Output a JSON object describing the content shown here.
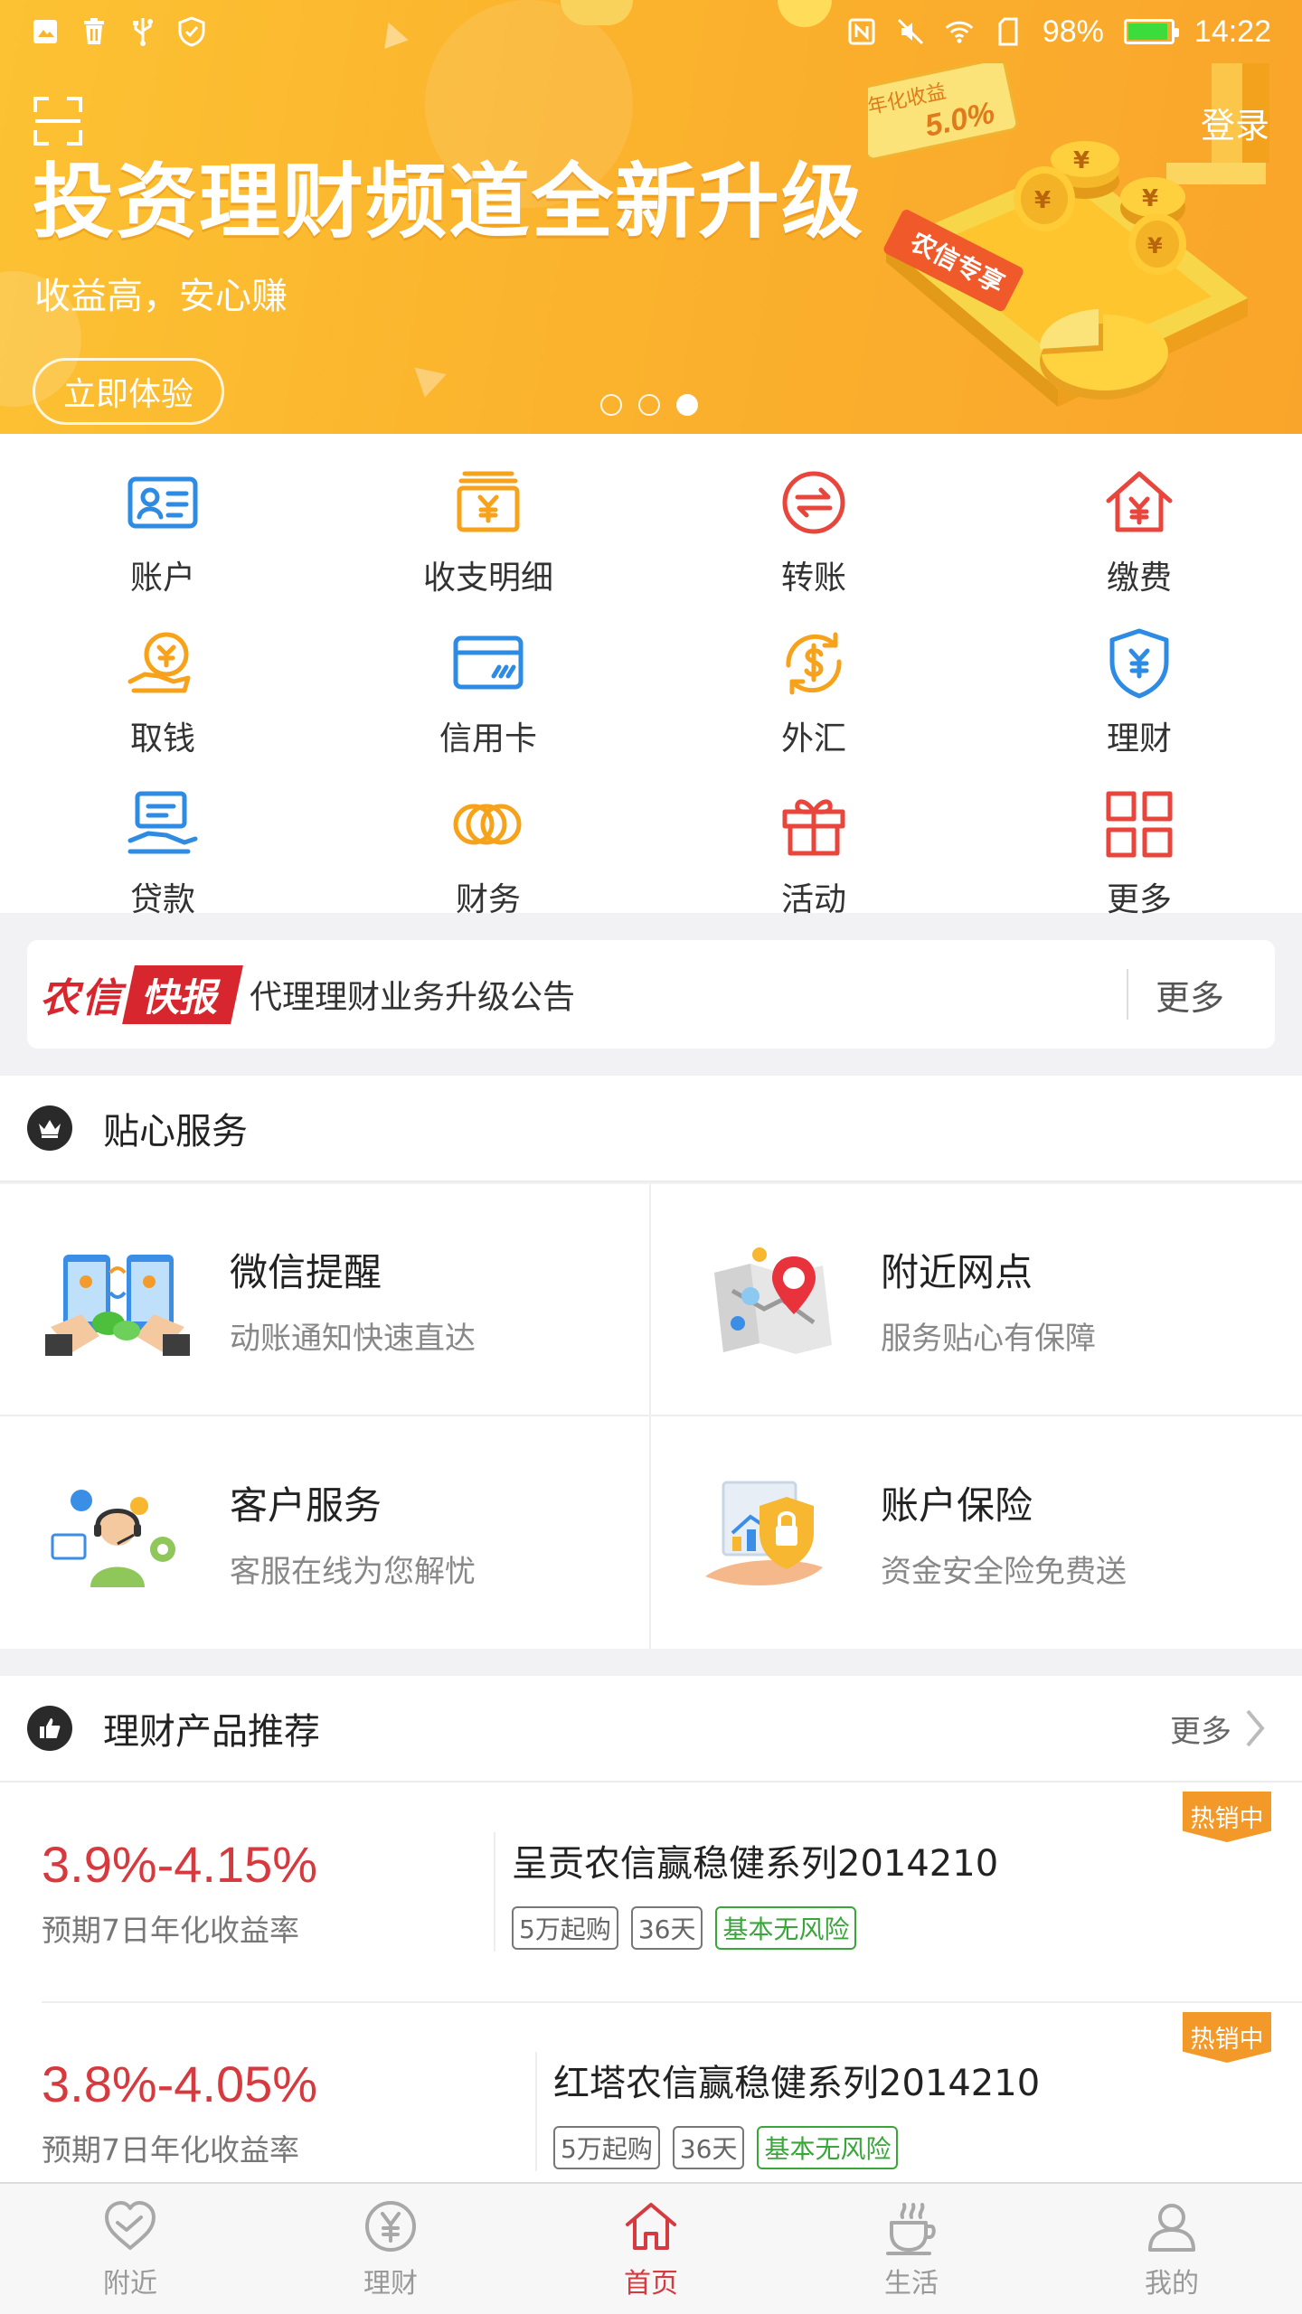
{
  "status_bar": {
    "battery": "98%",
    "time": "14:22"
  },
  "banner": {
    "title": "投资理财频道全新升级",
    "subtitle": "收益高，安心赚",
    "button": "立即体验",
    "login": "登录",
    "slide_count": 3,
    "active_slide": 3,
    "art_badge": "年化收益",
    "art_rate": "5.0%",
    "art_card": "农信专享",
    "currency_symbol": "¥"
  },
  "colors": {
    "accent_red": "#d63a3f",
    "blue": "#2e8be3",
    "orange": "#f7a21b",
    "green": "#3aa63a",
    "banner": "#fbb32d"
  },
  "menu": [
    {
      "label": "账户",
      "icon": "id-card-icon",
      "color": "#2e8be3"
    },
    {
      "label": "收支明细",
      "icon": "money-box-icon",
      "color": "#f7a21b"
    },
    {
      "label": "转账",
      "icon": "transfer-icon",
      "color": "#e8453c"
    },
    {
      "label": "缴费",
      "icon": "house-yen-icon",
      "color": "#e8453c"
    },
    {
      "label": "取钱",
      "icon": "withdraw-icon",
      "color": "#f7a21b"
    },
    {
      "label": "信用卡",
      "icon": "credit-card-icon",
      "color": "#2e8be3"
    },
    {
      "label": "外汇",
      "icon": "dollar-exchange-icon",
      "color": "#f7a21b"
    },
    {
      "label": "理财",
      "icon": "shield-yen-icon",
      "color": "#2e8be3"
    },
    {
      "label": "贷款",
      "icon": "loan-icon",
      "color": "#2e8be3"
    },
    {
      "label": "财务",
      "icon": "coins-icon",
      "color": "#f7a21b"
    },
    {
      "label": "活动",
      "icon": "gift-icon",
      "color": "#e8453c"
    },
    {
      "label": "更多",
      "icon": "grid-icon",
      "color": "#e8453c"
    }
  ],
  "news": {
    "logo_a": "农信",
    "logo_b": "快报",
    "text": "代理理财业务升级公告",
    "more": "更多"
  },
  "services_section": {
    "title": "贴心服务"
  },
  "services": [
    {
      "title": "微信提醒",
      "desc": "动账通知快速直达",
      "icon": "wechat-phones-icon"
    },
    {
      "title": "附近网点",
      "desc": "服务贴心有保障",
      "icon": "map-pin-icon"
    },
    {
      "title": "客户服务",
      "desc": "客服在线为您解忧",
      "icon": "support-agent-icon"
    },
    {
      "title": "账户保险",
      "desc": "资金安全险免费送",
      "icon": "lock-shield-icon"
    }
  ],
  "products_section": {
    "title": "理财产品推荐",
    "more": "更多"
  },
  "products": [
    {
      "rate": "3.9%-4.15%",
      "rate_label": "预期7日年化收益率",
      "name": "呈贡农信赢稳健系列2014210",
      "tags": [
        "5万起购",
        "36天",
        "基本无风险"
      ],
      "badge": "热销中"
    },
    {
      "rate": "3.8%-4.05%",
      "rate_label": "预期7日年化收益率",
      "name": "红塔农信赢稳健系列2014210",
      "tags": [
        "5万起购",
        "36天",
        "基本无风险"
      ],
      "badge": "热销中"
    }
  ],
  "bottom_nav": [
    {
      "label": "附近",
      "icon": "heart-icon"
    },
    {
      "label": "理财",
      "icon": "yen-circle-icon"
    },
    {
      "label": "首页",
      "icon": "home-icon",
      "active": true
    },
    {
      "label": "生活",
      "icon": "coffee-icon"
    },
    {
      "label": "我的",
      "icon": "user-icon"
    }
  ]
}
